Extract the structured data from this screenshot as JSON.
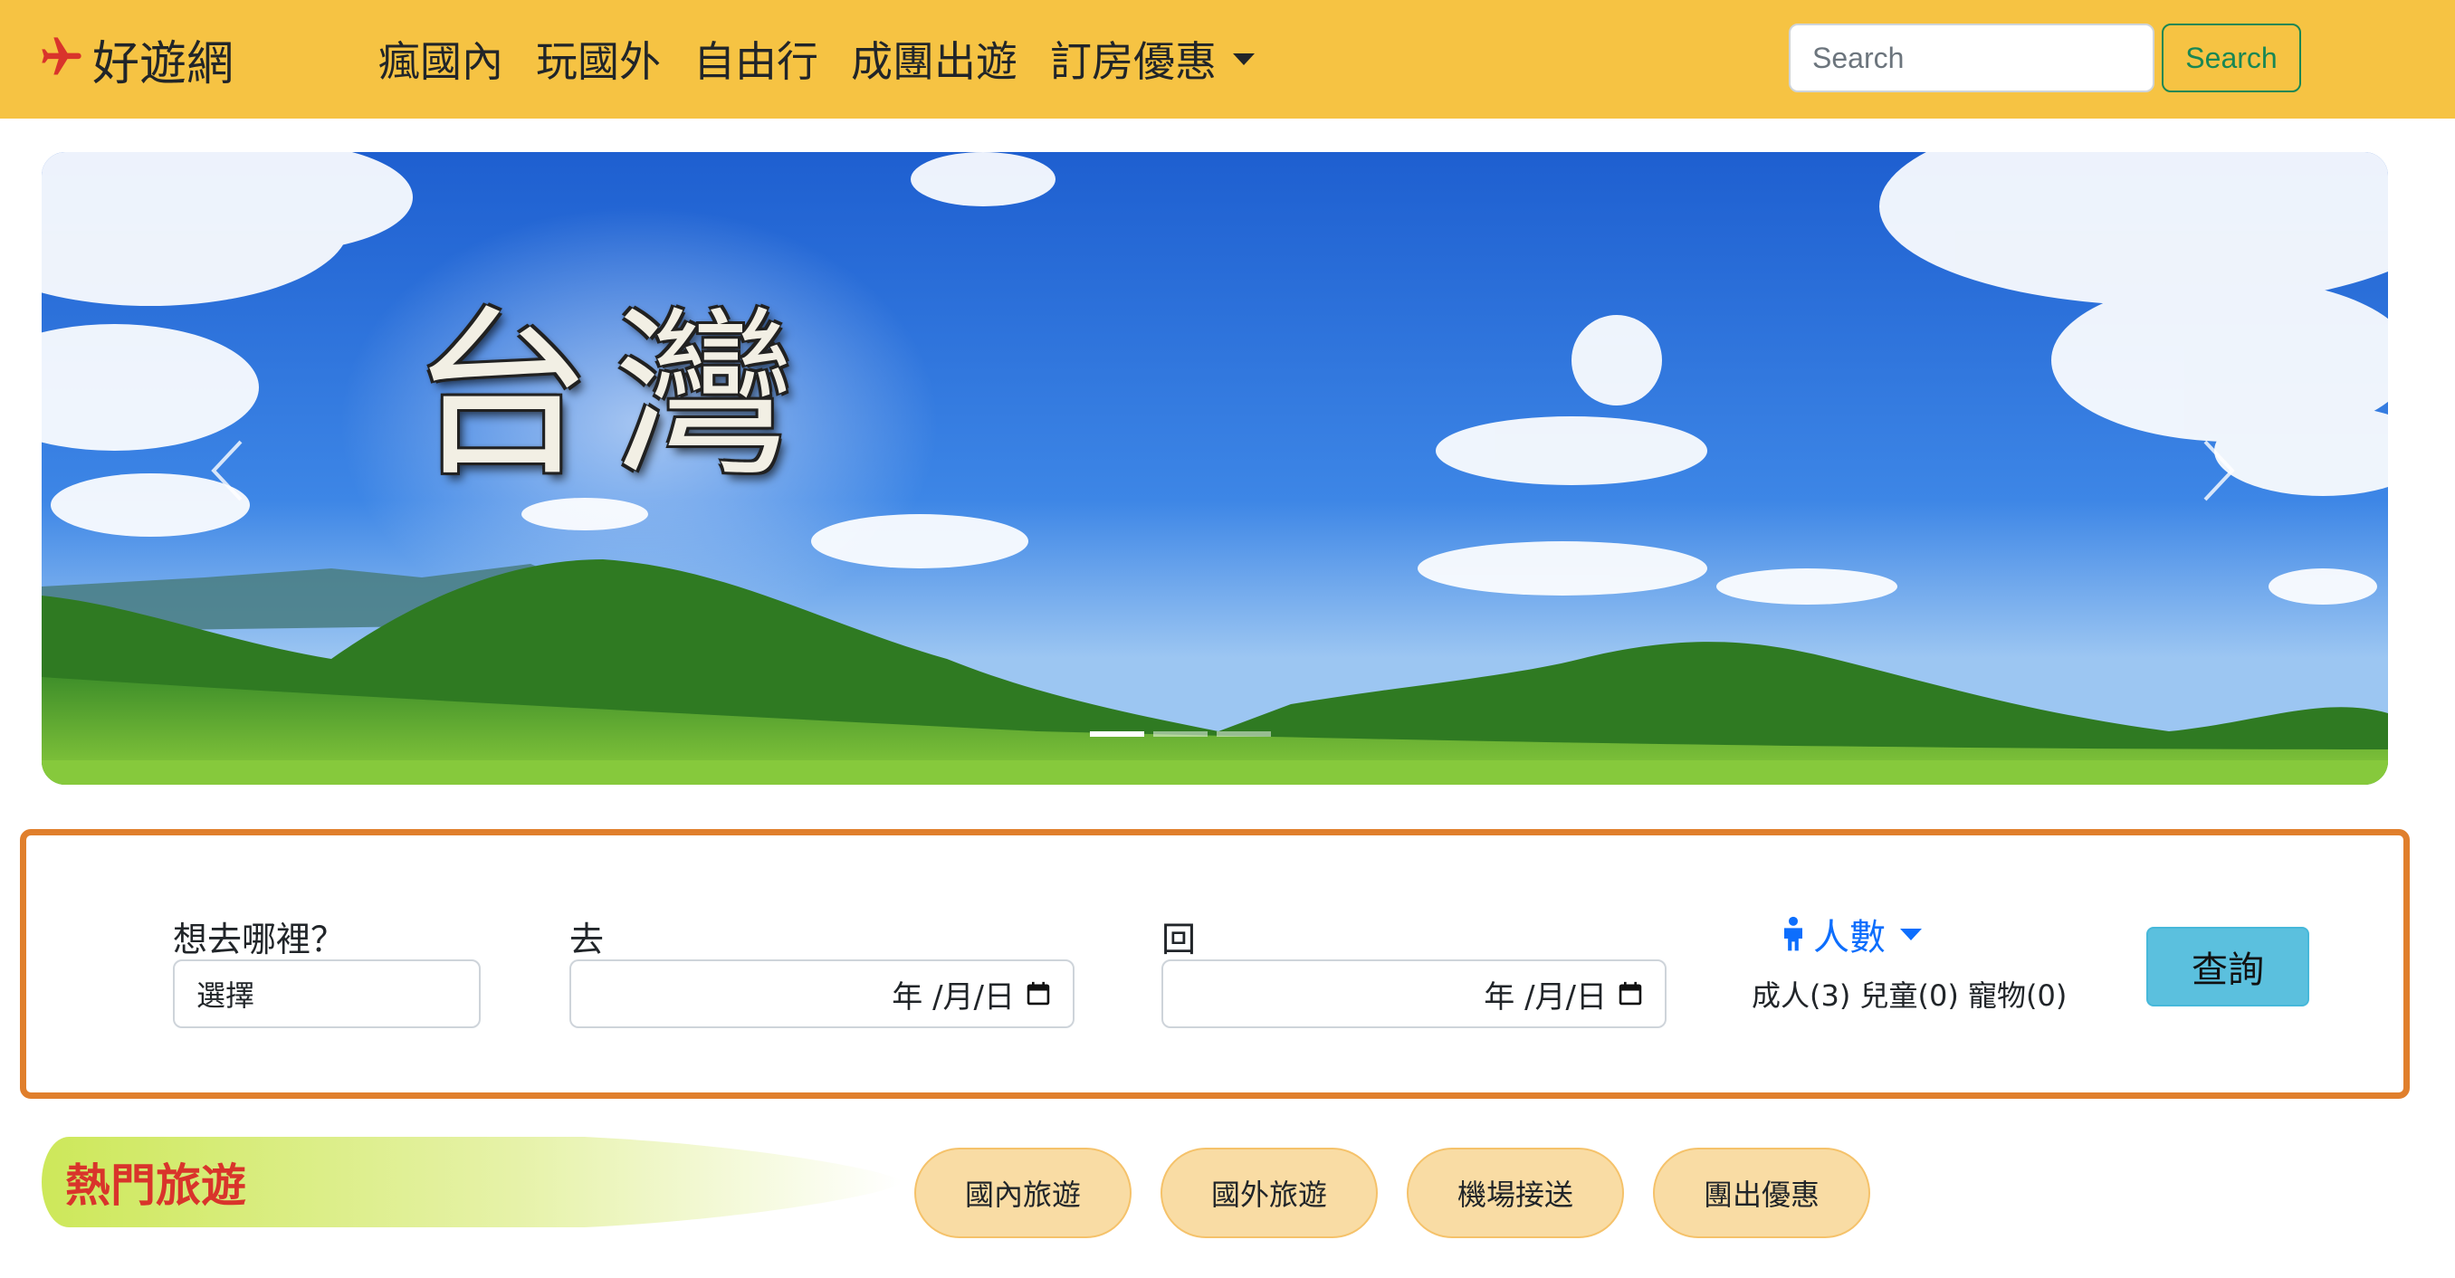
{
  "navbar": {
    "brand": "好遊網",
    "brand_icon": "airplane-icon",
    "links": [
      "瘋國內",
      "玩國外",
      "自由行",
      "成團出遊"
    ],
    "dropdown_label": "訂房優惠",
    "search_placeholder": "Search",
    "search_button": "Search",
    "bg_color": "#f6c343"
  },
  "hero": {
    "title": "台灣",
    "prev_icon": "chevron-left-icon",
    "next_icon": "chevron-right-icon",
    "active_slide": 1,
    "slide_count": 3
  },
  "search_panel": {
    "destination_label": "想去哪裡？",
    "destination_value": "選擇",
    "depart_label": "去",
    "return_label": "回",
    "date_placeholder": "年 /月/日",
    "people_label": "人數",
    "people_summary": "成人(3) 兒童(0) 寵物(0)",
    "query_button": "查詢",
    "border_color": "#e07f2c"
  },
  "hot_travel": {
    "title": "熱門旅遊",
    "pills": [
      "國內旅遊",
      "國外旅遊",
      "機場接送",
      "團出優惠"
    ]
  }
}
